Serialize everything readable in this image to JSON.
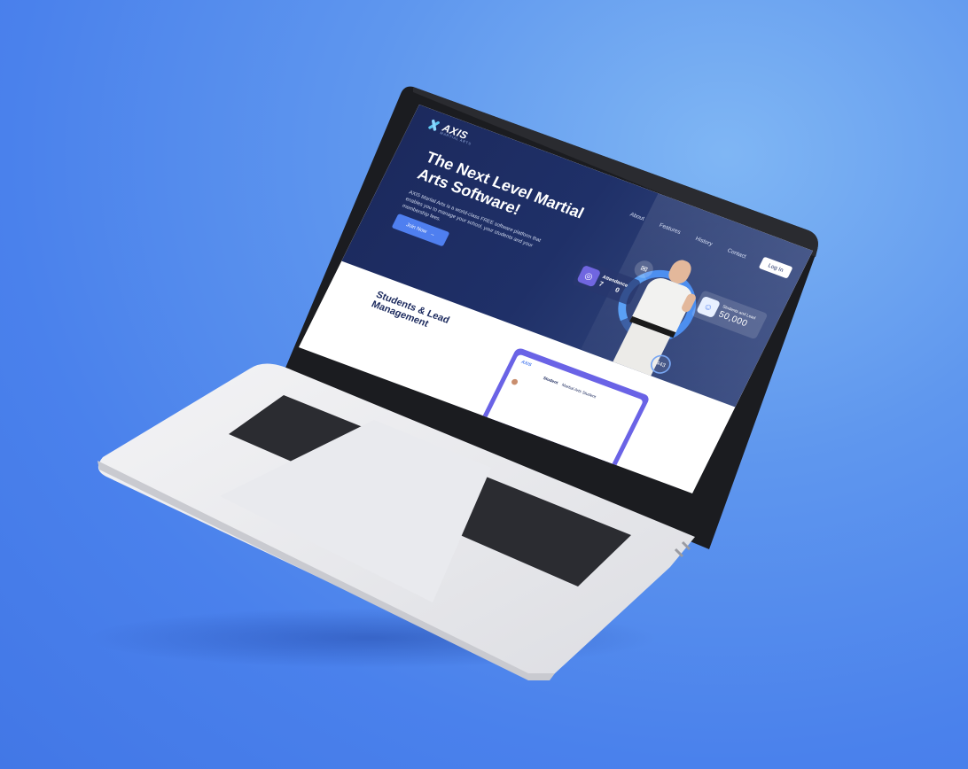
{
  "colors": {
    "background": "#4a81ec",
    "hero": "#1f3068",
    "accent": "#4f7ff0",
    "purple": "#6a63e6"
  },
  "site": {
    "logo_name": "AXIS",
    "logo_sub": "MARTIAL ARTS",
    "nav": {
      "about": "About",
      "features": "Features",
      "history": "History",
      "contact": "Contact",
      "login": "Log In"
    },
    "hero": {
      "title": "The Next Level Martial Arts Software!",
      "description": "AXIS Martial Arts is a world-class FREE software platform that enables you to manage your school, your students and your membership fees.",
      "cta": "Join Now",
      "cta_icon": "arrow-right-icon"
    },
    "widgets": {
      "mail_icon": "envelope-icon",
      "attendance_title": "Attendance",
      "attendance_icon": "fingerprint-icon",
      "attendance_left": "7",
      "attendance_right": "0",
      "students_title": "Students and Lead",
      "students_icon": "users-icon",
      "students_value": "50,000",
      "count_value": "443"
    },
    "section_title": "Students & Lead Management",
    "preview": {
      "logo": "AXIS",
      "tab_student": "Student",
      "tab_filter": "Martial Arts Student"
    }
  }
}
